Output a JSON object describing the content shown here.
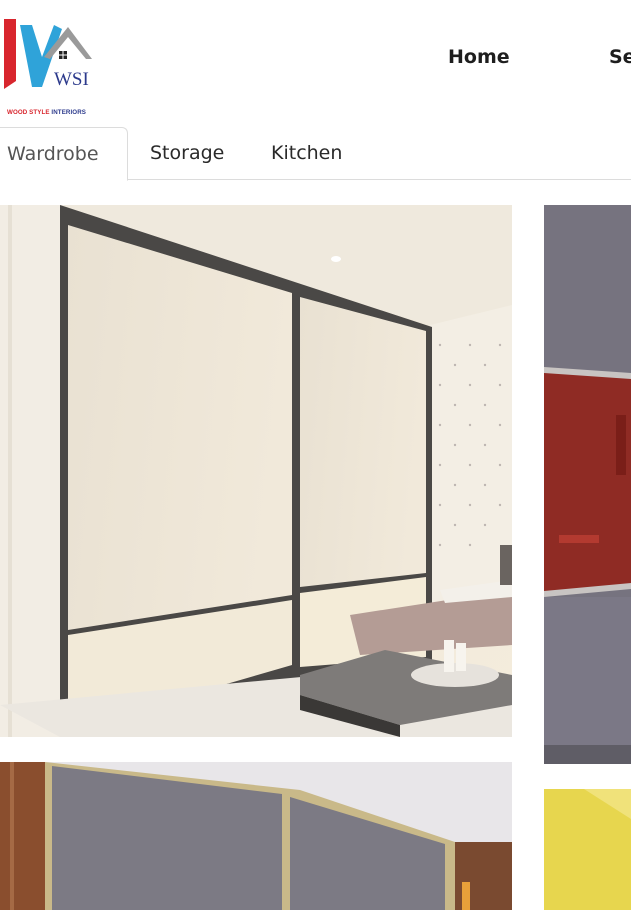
{
  "brand": {
    "logo_text": "WSI",
    "caption_part1": "WOOD STYLE",
    "caption_part2": "INTERIORS",
    "colors": {
      "red": "#d8262e",
      "blue": "#2fa3d9",
      "gray": "#9a9a9a",
      "navy": "#2c3a8c"
    }
  },
  "nav": {
    "items": [
      {
        "label": "Home"
      },
      {
        "label": "Se"
      }
    ]
  },
  "tabs": {
    "items": [
      {
        "label": "Wardrobe",
        "active": true
      },
      {
        "label": "Storage",
        "active": false
      },
      {
        "label": "Kitchen",
        "active": false
      }
    ]
  },
  "gallery": {
    "items": [
      {
        "name": "white-gloss-sliding-wardrobe",
        "theme": "cream"
      },
      {
        "name": "grey-red-sliding-wardrobe",
        "theme": "grey-red"
      },
      {
        "name": "grey-gold-frame-wardrobe",
        "theme": "grey-gold"
      },
      {
        "name": "yellow-wardrobe",
        "theme": "yellow"
      }
    ]
  }
}
